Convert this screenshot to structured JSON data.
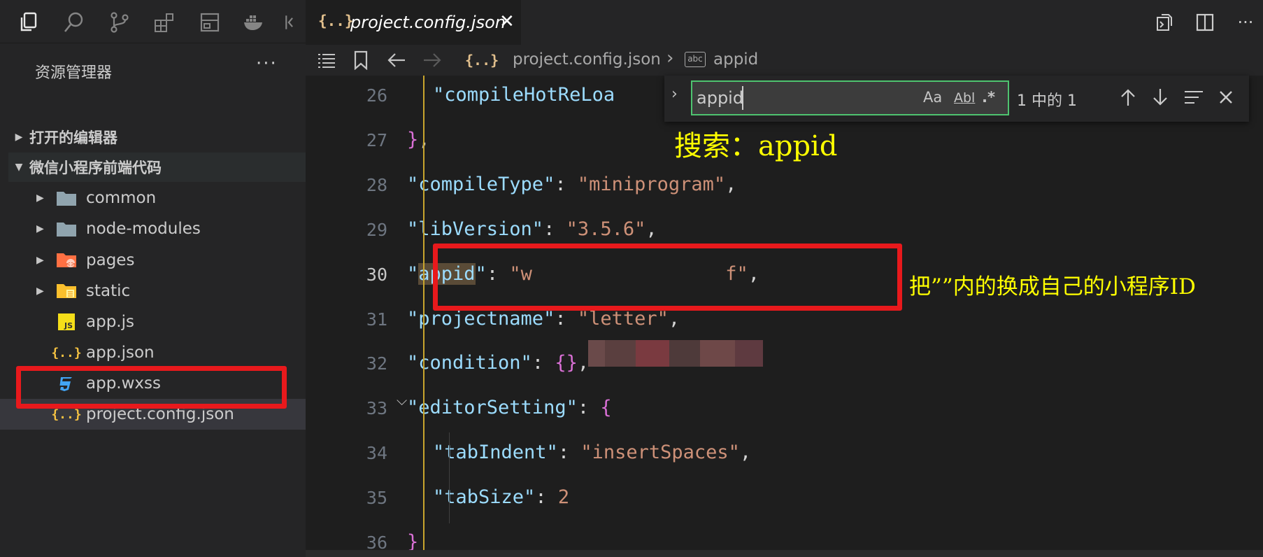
{
  "activity_bar": {
    "icons": [
      "explorer-icon",
      "search-icon",
      "source-control-icon",
      "extensions-icon",
      "layout-icon",
      "docker-icon",
      "more-views-icon"
    ]
  },
  "sidebar": {
    "title": "资源管理器",
    "more": "···",
    "sections": [
      {
        "label": "打开的编辑器",
        "expanded": false
      },
      {
        "label": "微信小程序前端代码",
        "expanded": true
      }
    ],
    "items": [
      {
        "label": "common",
        "type": "folder"
      },
      {
        "label": "node-modules",
        "type": "folder"
      },
      {
        "label": "pages",
        "type": "folder-pages"
      },
      {
        "label": "static",
        "type": "folder-static"
      },
      {
        "label": "app.js",
        "type": "js"
      },
      {
        "label": "app.json",
        "type": "json"
      },
      {
        "label": "app.wxss",
        "type": "css"
      },
      {
        "label": "project.config.json",
        "type": "json",
        "selected": true
      }
    ]
  },
  "tab": {
    "icon": "{..}",
    "label": "project.config.json",
    "close": "✕"
  },
  "breadcrumb": {
    "file_icon": "{..}",
    "file": "project.config.json",
    "sep": "›",
    "symbol_icon": "abc",
    "symbol": "appid"
  },
  "find": {
    "value": "appid",
    "match_case": "Aa",
    "whole_word": "Abl",
    "regex": ".*",
    "count": "1 中的 1"
  },
  "editor": {
    "current_line": 30,
    "lines": [
      {
        "num": "26",
        "tokens": [
          [
            "k",
            "\"compileHotReLoa"
          ]
        ]
      },
      {
        "num": "27",
        "tokens": [
          [
            "b1",
            "}"
          ],
          [
            "p",
            ","
          ]
        ]
      },
      {
        "num": "28",
        "tokens": [
          [
            "k",
            "\"compileType\""
          ],
          [
            "p",
            ": "
          ],
          [
            "s",
            "\"miniprogram\""
          ],
          [
            "p",
            ","
          ]
        ]
      },
      {
        "num": "29",
        "tokens": [
          [
            "k",
            "\"libVersion\""
          ],
          [
            "p",
            ": "
          ],
          [
            "s",
            "\"3.5.6\""
          ],
          [
            "p",
            ","
          ]
        ]
      },
      {
        "num": "30",
        "tokens": [
          [
            "k",
            "\""
          ],
          [
            "khl",
            "appid"
          ],
          [
            "k",
            "\""
          ],
          [
            "p",
            ": "
          ],
          [
            "s",
            "\"w"
          ],
          [
            "s",
            "                 "
          ],
          [
            "s",
            "f\""
          ],
          [
            "p",
            ","
          ]
        ]
      },
      {
        "num": "31",
        "tokens": [
          [
            "k",
            "\"projectname\""
          ],
          [
            "p",
            ": "
          ],
          [
            "s",
            "\"letter\""
          ],
          [
            "p",
            ","
          ]
        ]
      },
      {
        "num": "32",
        "tokens": [
          [
            "k",
            "\"condition\""
          ],
          [
            "p",
            ": "
          ],
          [
            "b1",
            "{}"
          ],
          [
            "p",
            ","
          ]
        ]
      },
      {
        "num": "33",
        "tokens": [
          [
            "k",
            "\"editorSetting\""
          ],
          [
            "p",
            ": "
          ],
          [
            "b1",
            "{"
          ]
        ]
      },
      {
        "num": "34",
        "tokens": [
          [
            "p",
            "  "
          ],
          [
            "k",
            "\"tabIndent\""
          ],
          [
            "p",
            ": "
          ],
          [
            "s",
            "\"insertSpaces\""
          ],
          [
            "p",
            ","
          ]
        ]
      },
      {
        "num": "35",
        "tokens": [
          [
            "p",
            "  "
          ],
          [
            "k",
            "\"tabSize\""
          ],
          [
            "p",
            ": "
          ],
          [
            "s",
            "2"
          ]
        ]
      },
      {
        "num": "36",
        "tokens": [
          [
            "b1",
            "}"
          ]
        ]
      }
    ]
  },
  "annotations": {
    "search_hint": "搜索：appid",
    "replace_hint": "把””内的换成自己的小程序ID"
  },
  "colors": {
    "highlight_box": "#e8191c",
    "annotation_text": "#ffff00",
    "find_border": "#4ec36f"
  }
}
